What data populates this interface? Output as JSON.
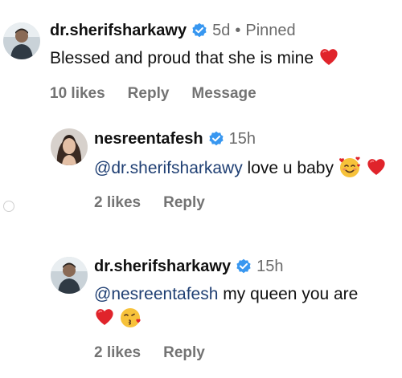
{
  "comments": [
    {
      "username": "dr.sherifsharkawy",
      "time": "5d",
      "separator": "•",
      "pinned_label": "Pinned",
      "text": "Blessed and proud that she is mine",
      "likes": "10 likes",
      "reply_label": "Reply",
      "message_label": "Message"
    },
    {
      "username": "nesreentafesh",
      "time": "15h",
      "mention": "@dr.sherifsharkawy",
      "text": " love u baby",
      "likes": "2 likes",
      "reply_label": "Reply"
    },
    {
      "username": "dr.sherifsharkawy",
      "time": "15h",
      "mention": "@nesreentafesh",
      "text": " my queen you are",
      "likes": "2 likes",
      "reply_label": "Reply"
    }
  ],
  "icons": {
    "verified": "verified-badge-icon",
    "heart": "red-heart-emoji",
    "smiling_hearts": "smiling-face-with-hearts-emoji",
    "kiss": "face-blowing-kiss-emoji"
  },
  "colors": {
    "verified": "#3897f0",
    "mention": "#1f3f73",
    "secondary_text": "#737373",
    "heart": "#e0242b"
  }
}
